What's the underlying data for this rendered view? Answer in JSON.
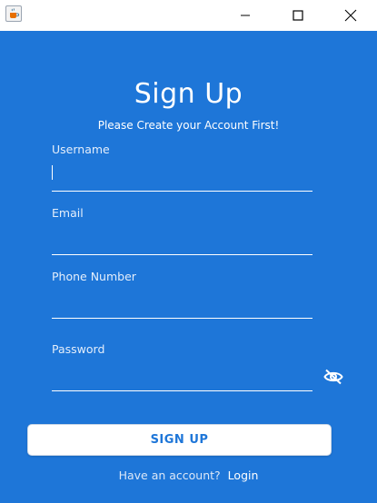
{
  "window": {
    "minimize_icon": "minimize-icon",
    "maximize_icon": "maximize-icon",
    "close_icon": "close-icon",
    "app_icon": "java-coffee-icon"
  },
  "form": {
    "title": "Sign Up",
    "subtitle": "Please Create your Account First!",
    "username_label": "Username",
    "username_value": "",
    "email_label": "Email",
    "email_value": "",
    "phone_label": "Phone Number",
    "phone_value": "",
    "password_label": "Password",
    "password_value": "",
    "password_toggle_icon": "eye-slash-icon",
    "submit_label": "SIGN UP",
    "footer_question": "Have an account?",
    "footer_link": "Login"
  },
  "colors": {
    "background": "#1e76d8",
    "button_text": "#1e76d8",
    "button_bg": "#ffffff",
    "text": "#ffffff"
  }
}
